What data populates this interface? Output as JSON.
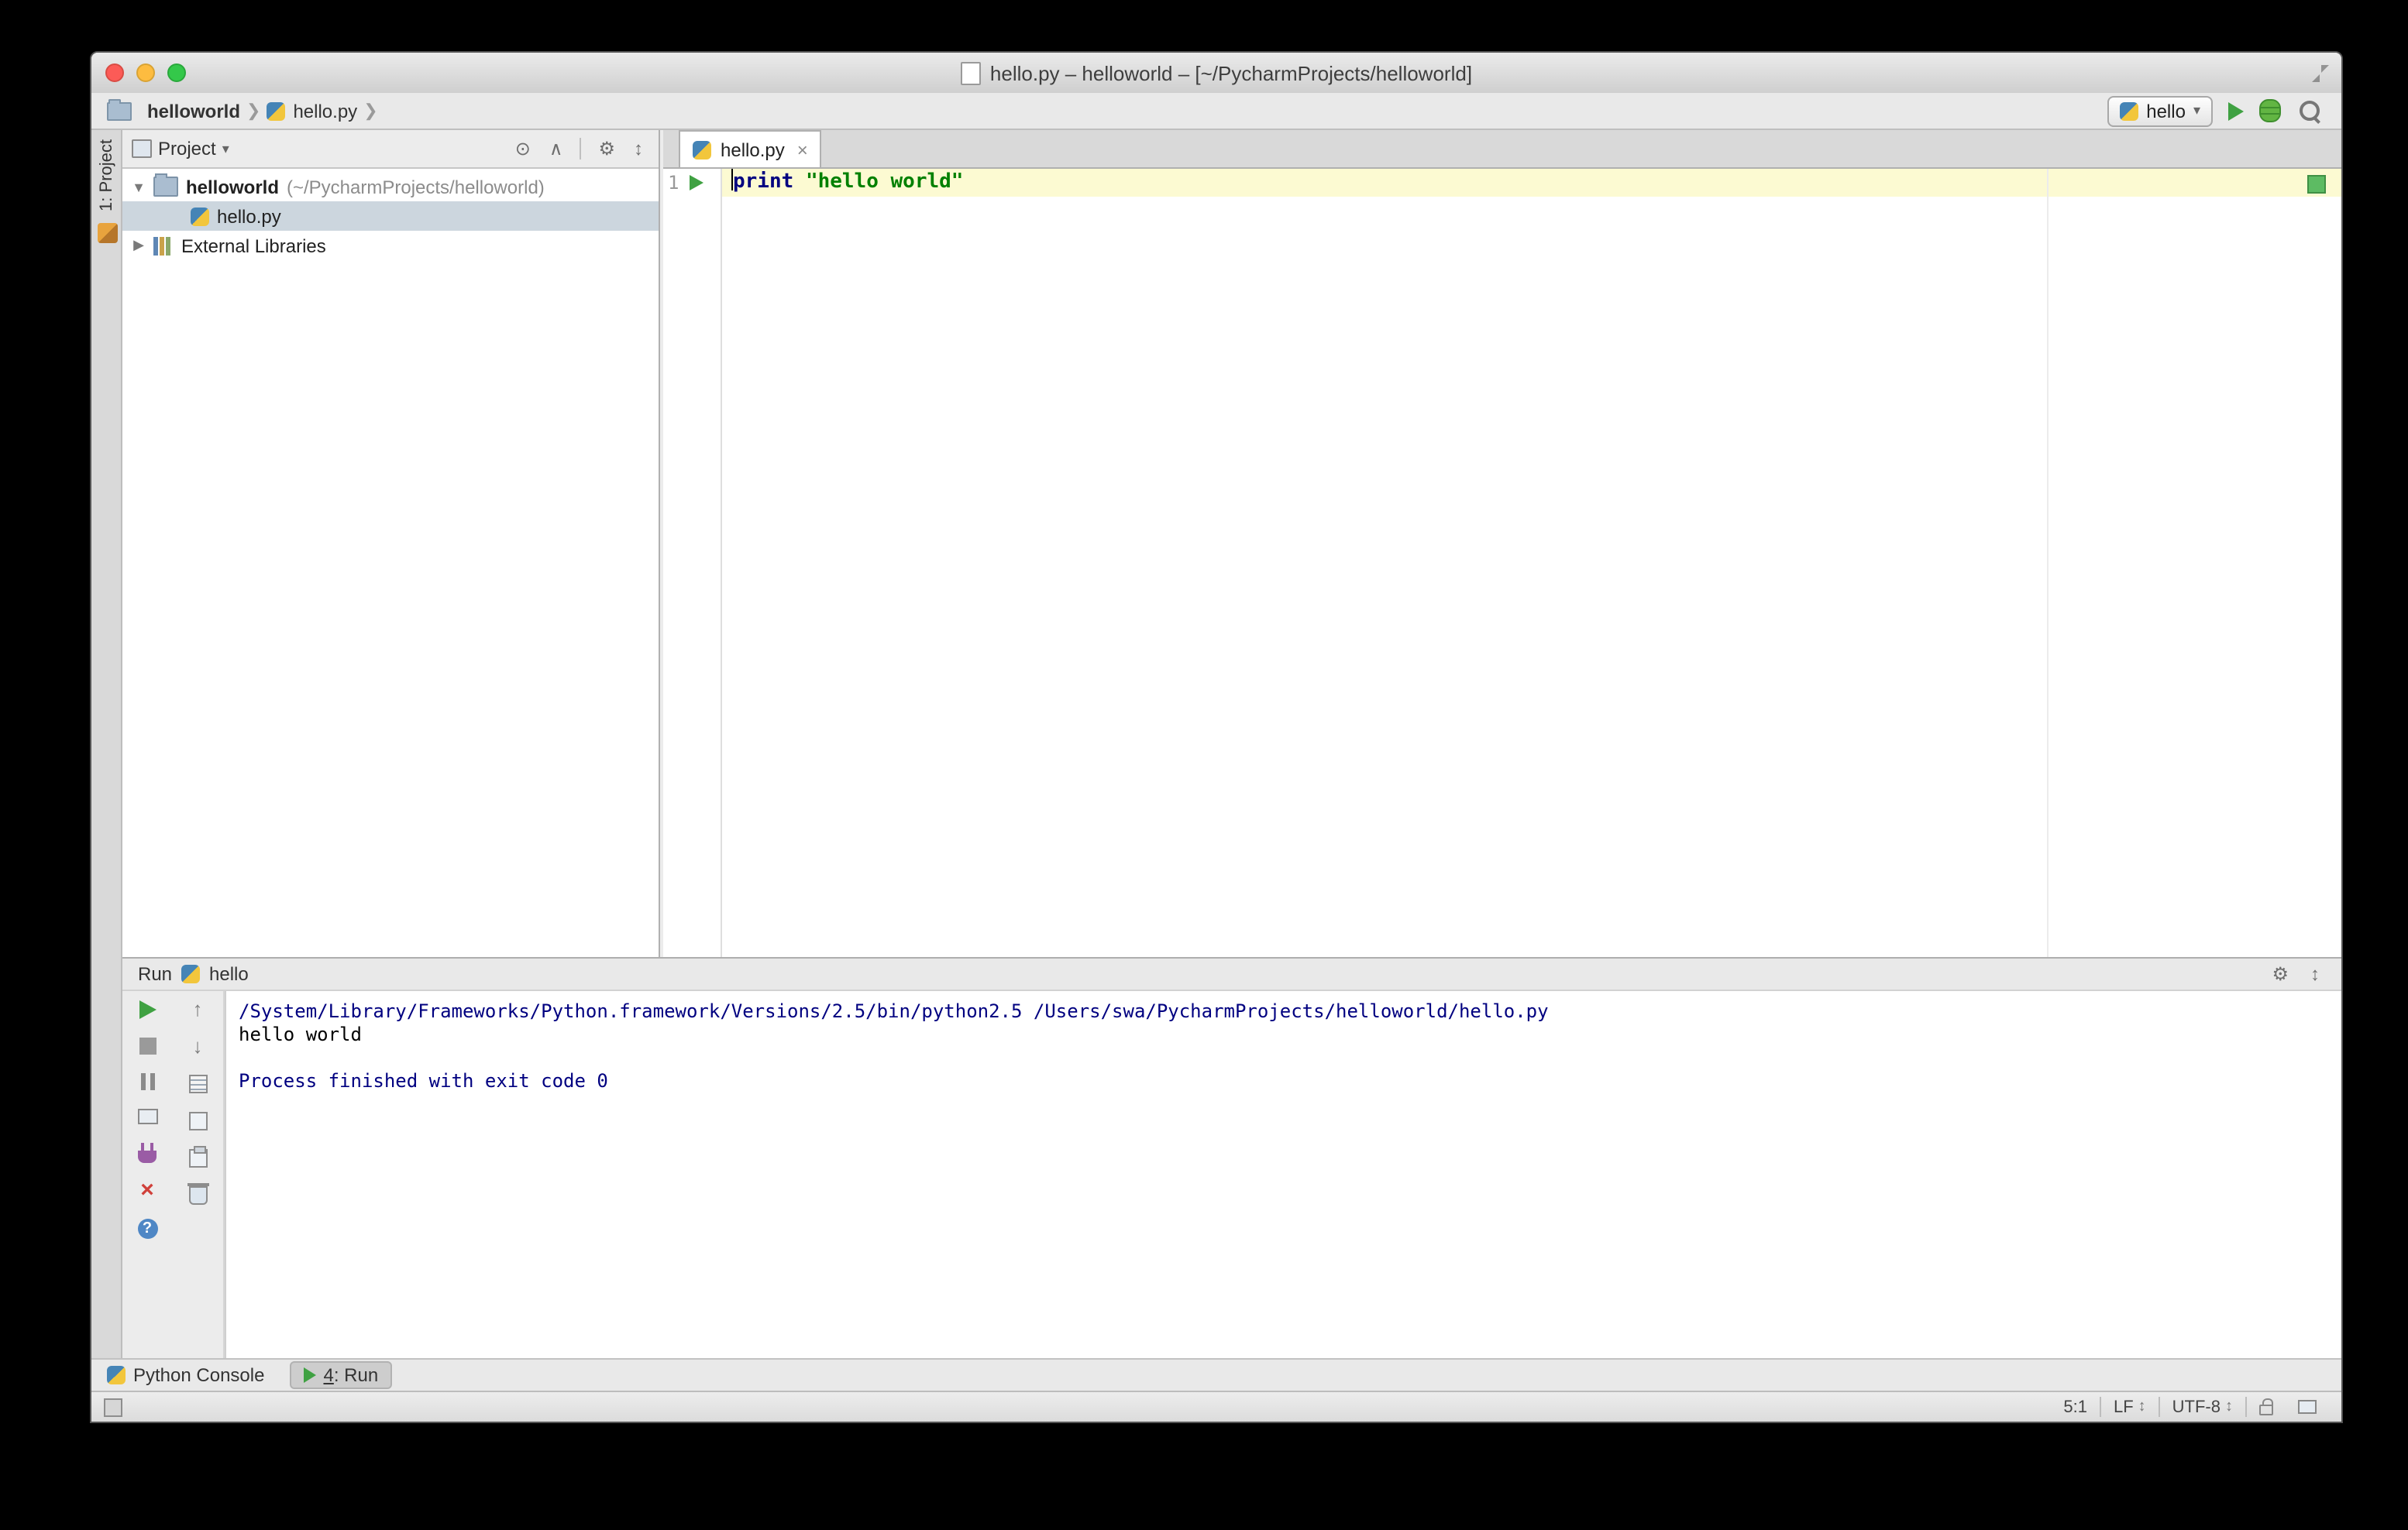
{
  "window": {
    "title": "hello.py – helloworld – [~/PycharmProjects/helloworld]"
  },
  "navbar": {
    "breadcrumb_project": "helloworld",
    "breadcrumb_file": "hello.py",
    "run_config": "hello"
  },
  "tool_stripe": {
    "project_tab": "1: Project"
  },
  "project_panel": {
    "header": "Project",
    "tree": {
      "root_name": "helloworld",
      "root_path": "(~/PycharmProjects/helloworld)",
      "file": "hello.py",
      "external_libs": "External Libraries"
    }
  },
  "editor": {
    "tab": "hello.py",
    "line_number": "1",
    "keyword": "print",
    "string": "\"hello world\""
  },
  "run_panel": {
    "title": "Run",
    "config": "hello",
    "console_line1": "/System/Library/Frameworks/Python.framework/Versions/2.5/bin/python2.5 /Users/swa/PycharmProjects/helloworld/hello.py",
    "console_line2": "hello world",
    "console_line3": "",
    "console_line4": "Process finished with exit code 0"
  },
  "bottom_bar": {
    "python_console": "Python Console",
    "run_tab_number": "4",
    "run_tab_suffix": ": Run"
  },
  "status_bar": {
    "caret_position": "5:1",
    "line_separator": "LF",
    "encoding": "UTF-8"
  },
  "colors": {
    "run_green": "#3fa142",
    "inspection_green": "#5dbb63",
    "keyword_navy": "#000080",
    "string_green": "#008000",
    "console_system_navy": "#000080",
    "selection_gray_blue": "#ccd6de",
    "line_highlight_yellow": "#fcfad2"
  }
}
